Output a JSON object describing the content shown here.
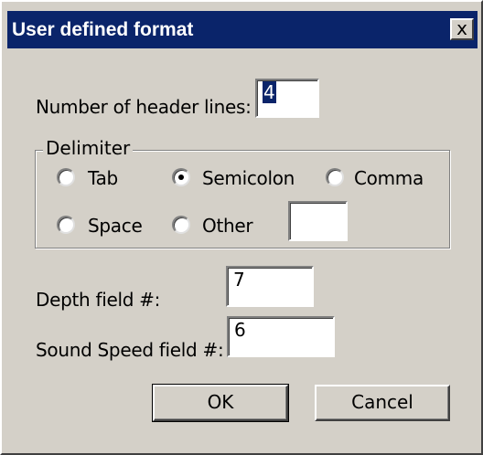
{
  "window": {
    "title": "User defined format",
    "close_label": "x"
  },
  "header_lines": {
    "label": "Number of header lines:",
    "value": "4"
  },
  "delimiter": {
    "caption": "Delimiter",
    "selected": "Semicolon",
    "options": {
      "tab": "Tab",
      "semicolon": "Semicolon",
      "comma": "Comma",
      "space": "Space",
      "other": "Other"
    },
    "other_value": ""
  },
  "depth_field": {
    "label": "Depth field #:",
    "value": "7"
  },
  "sound_speed_field": {
    "label": "Sound Speed field #:",
    "value": "6"
  },
  "buttons": {
    "ok": "OK",
    "cancel": "Cancel"
  }
}
